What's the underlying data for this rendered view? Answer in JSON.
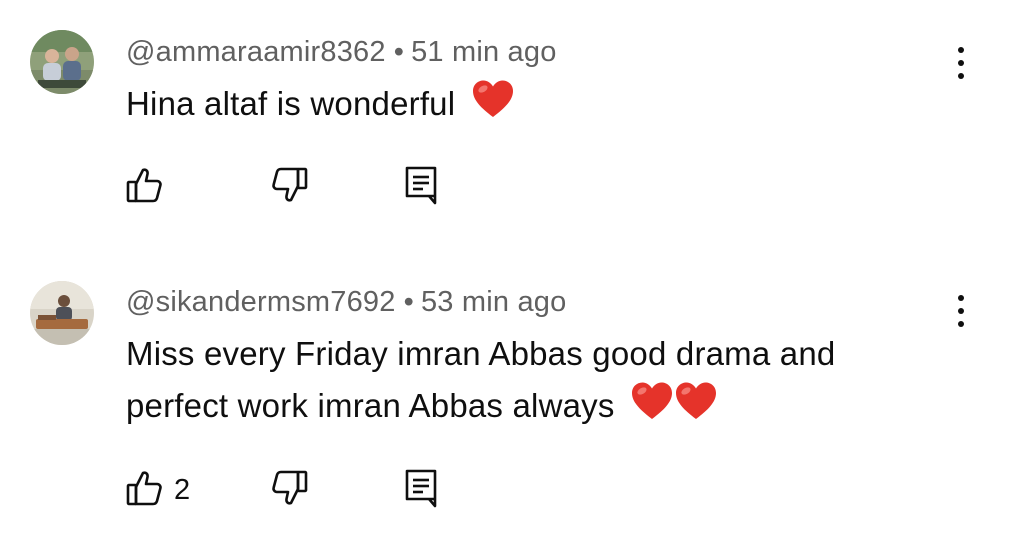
{
  "comments": [
    {
      "author": "@ammaraamir8362",
      "separator": "•",
      "time": "51 min ago",
      "text": "Hina altaf is wonderful",
      "emojis": [
        "heart"
      ],
      "likes": "",
      "avatar_icon": "avatar-two-children-photo"
    },
    {
      "author": "@sikandermsm7692",
      "separator": "•",
      "time": "53 min ago",
      "text": "Miss every Friday imran Abbas good drama and perfect work imran Abbas always",
      "emojis": [
        "heart",
        "heart"
      ],
      "likes": "2",
      "avatar_icon": "avatar-man-at-desk-photo"
    }
  ],
  "icons": {
    "like": "thumbs-up-icon",
    "dislike": "thumbs-down-icon",
    "reply": "reply-comment-icon",
    "menu": "more-vertical-icon",
    "emoji": "red-heart-emoji"
  },
  "colors": {
    "text": "#0f0f0f",
    "meta": "#606060",
    "heart": "#e5332a",
    "background": "#ffffff"
  }
}
